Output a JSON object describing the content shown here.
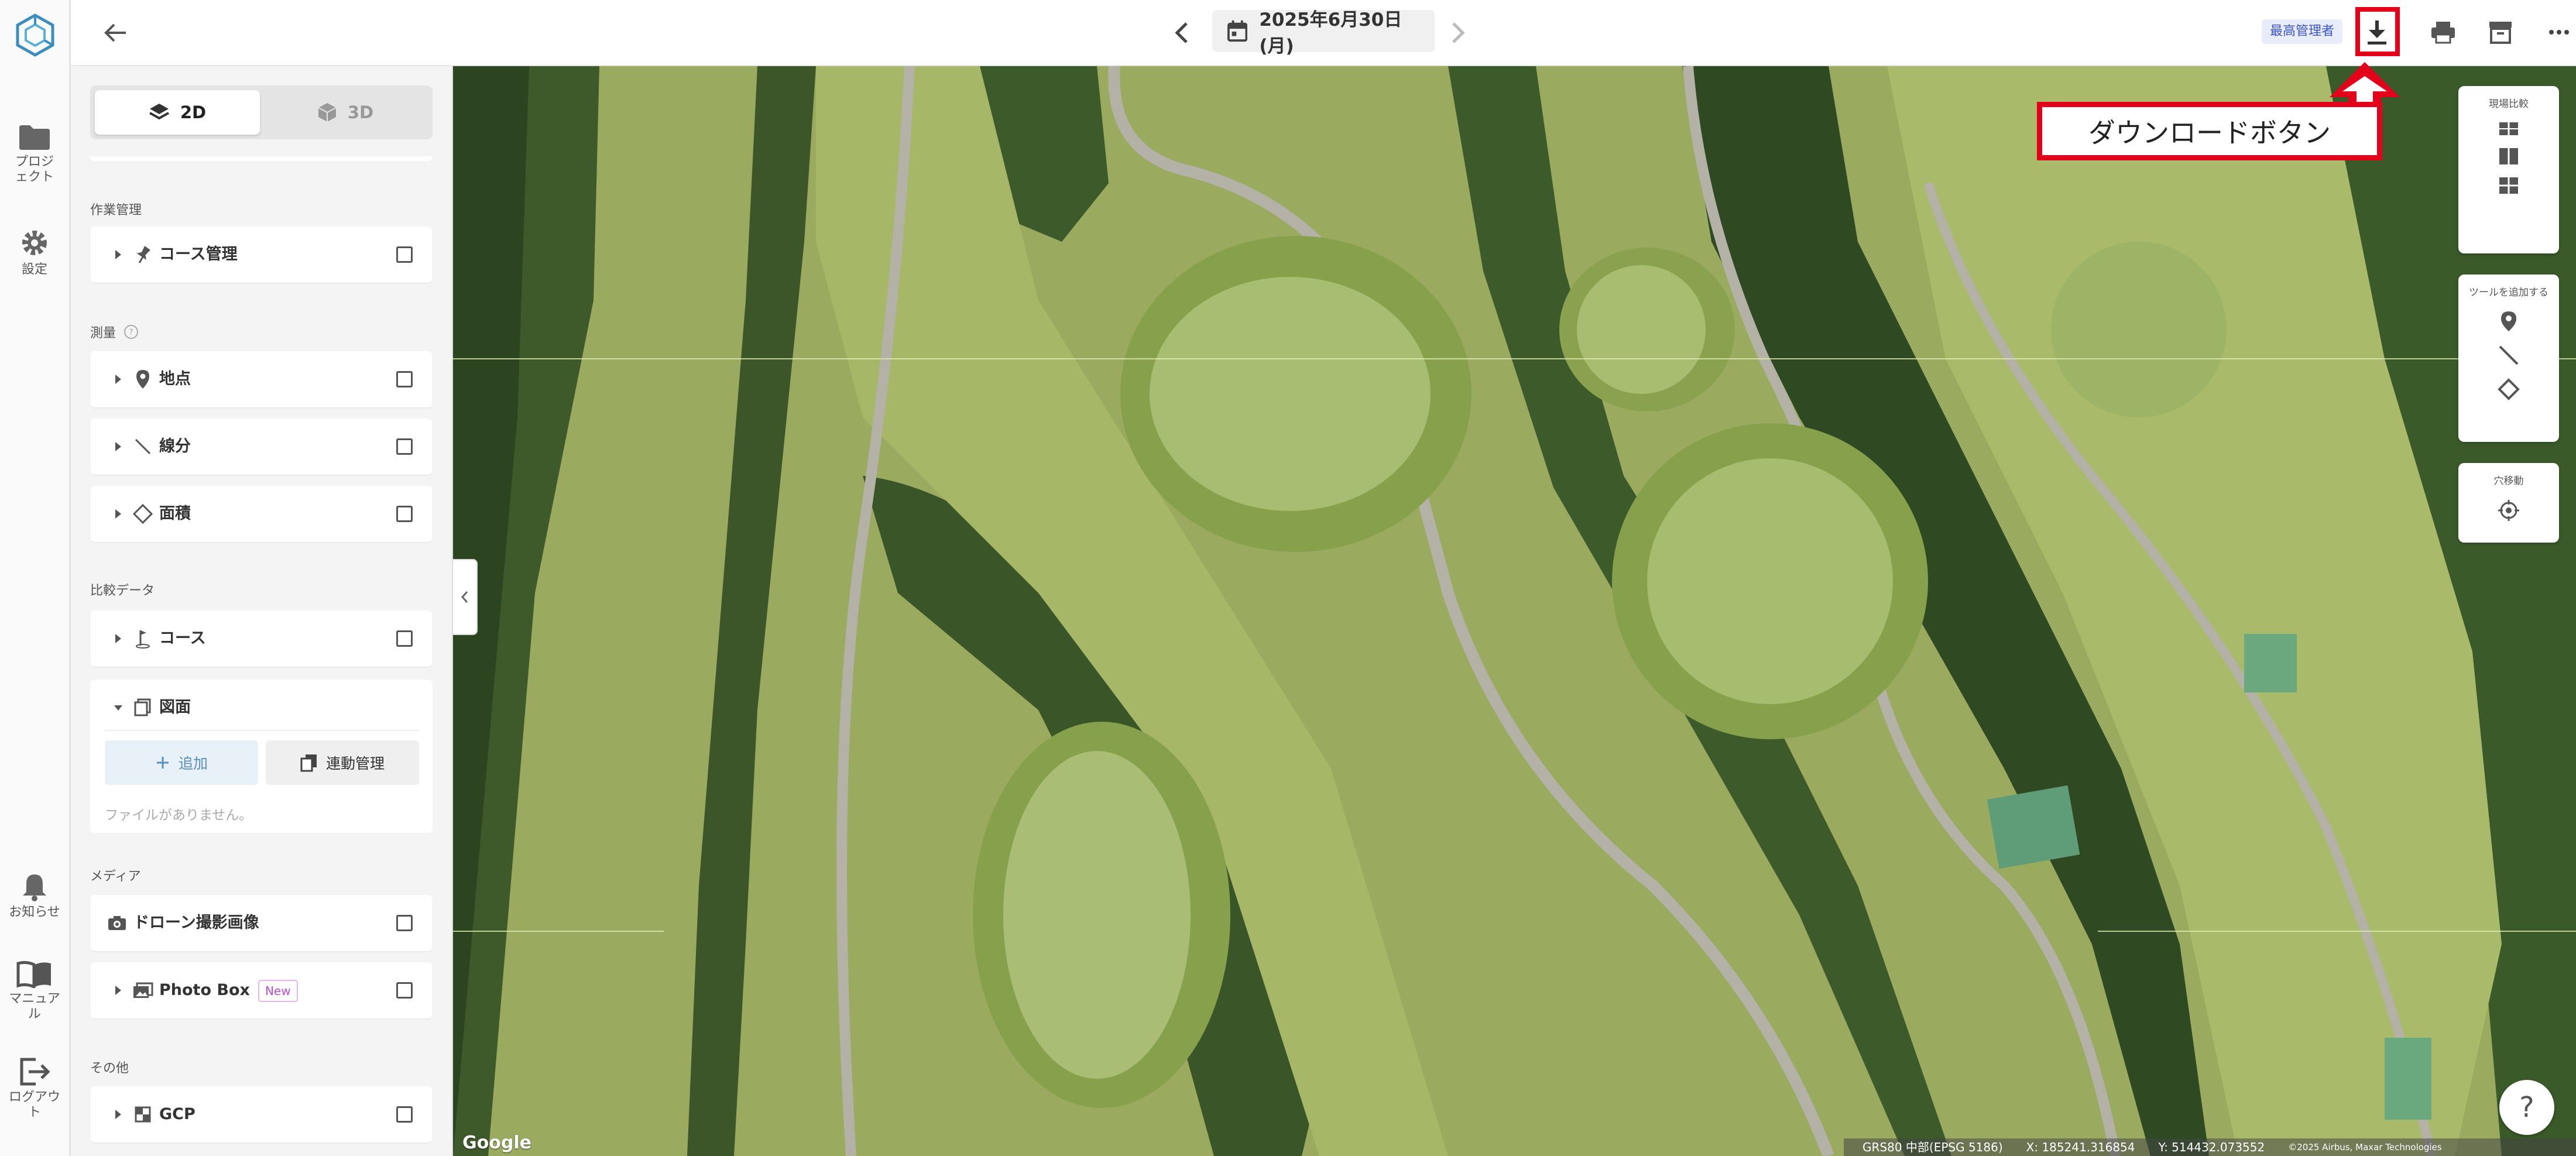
{
  "rail": {
    "items": [
      {
        "label": "プロジェクト",
        "icon": "folder-icon"
      },
      {
        "label": "設定",
        "icon": "gear-icon"
      },
      {
        "label": "お知らせ",
        "icon": "bell-icon"
      },
      {
        "label": "マニュアル",
        "icon": "book-icon"
      },
      {
        "label": "ログアウト",
        "icon": "logout-icon"
      }
    ]
  },
  "topbar": {
    "date": "2025年6月30日 (月)",
    "role_badge": "最高管理者"
  },
  "panel": {
    "mode_2d": "2D",
    "mode_3d": "3D",
    "sections": {
      "work": "作業管理",
      "survey": "測量",
      "compare": "比較データ",
      "media": "メディア",
      "other": "その他"
    },
    "items": {
      "course_mgmt": "コース管理",
      "point": "地点",
      "line": "線分",
      "area": "面積",
      "course": "コース",
      "drawing": "図面",
      "drone": "ドローン撮影画像",
      "photobox": "Photo Box",
      "gcp": "GCP"
    },
    "new_badge": "New",
    "add_button": "追加",
    "link_button": "連動管理",
    "empty_note": "ファイルがありません。"
  },
  "map": {
    "tools_compare_title": "現場比較",
    "tools_add_title": "ツールを追加する",
    "tools_move_title": "穴移動",
    "help": "?",
    "google": "Google",
    "status": {
      "crs": "GRS80 中部(EPSG 5186)",
      "x": "X: 185241.316854",
      "y": "Y: 514432.073552",
      "attrib": "©2025 Airbus, Maxar Technologies"
    }
  },
  "callout": {
    "text": "ダウンロードボタン"
  },
  "colors": {
    "highlight": "#e4001b",
    "accent": "#3d56c8"
  }
}
